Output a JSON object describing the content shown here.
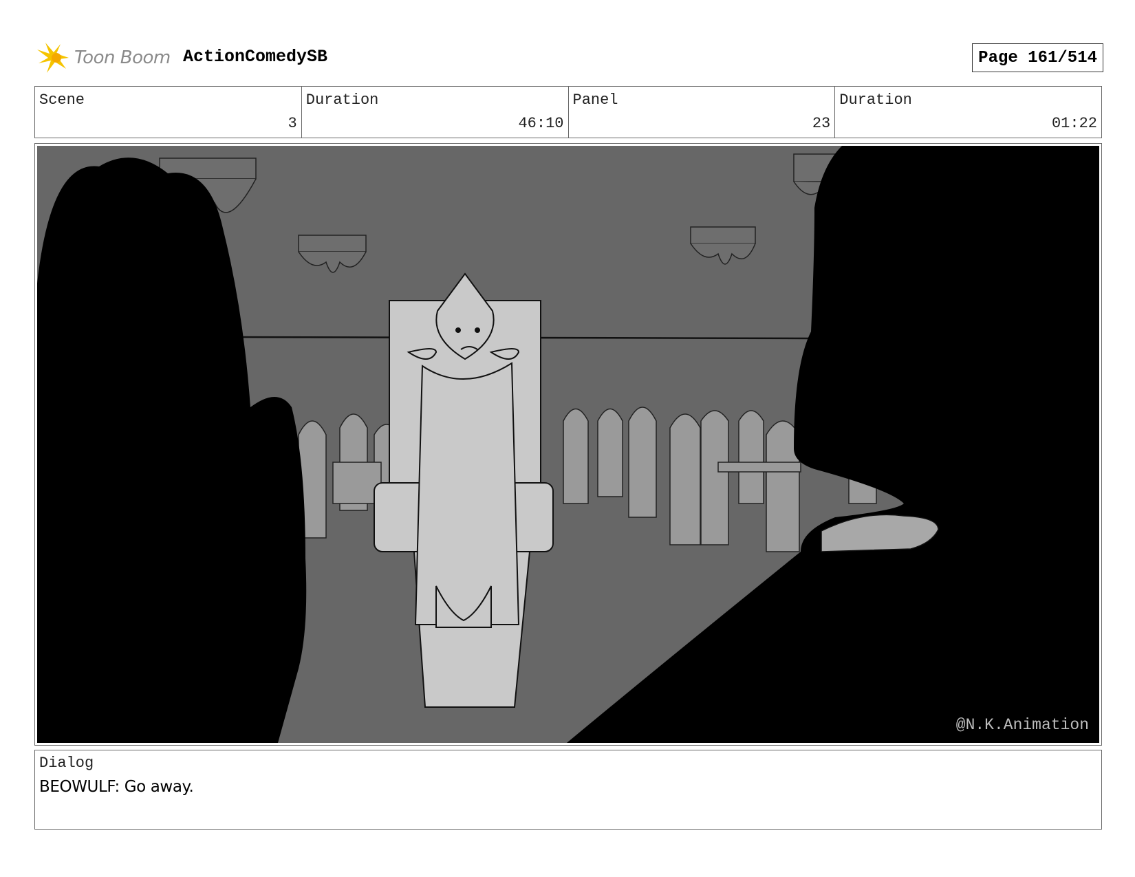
{
  "header": {
    "logo_text": "Toon Boom",
    "project_title": "ActionComedySB",
    "page_label": "Page 161/514"
  },
  "info": {
    "scene_label": "Scene",
    "scene_value": "3",
    "scene_duration_label": "Duration",
    "scene_duration_value": "46:10",
    "panel_label": "Panel",
    "panel_value": "23",
    "panel_duration_label": "Duration",
    "panel_duration_value": "01:22"
  },
  "frame": {
    "watermark": "@N.K.Animation"
  },
  "dialog": {
    "label": "Dialog",
    "text": "BEOWULF: Go away."
  },
  "colors": {
    "logo_yellow": "#f5c400",
    "logo_text_gray": "#8a8a8a",
    "wall_gray": "#676767",
    "figure_light": "#c9c9c9",
    "silhouette": "#000000"
  }
}
